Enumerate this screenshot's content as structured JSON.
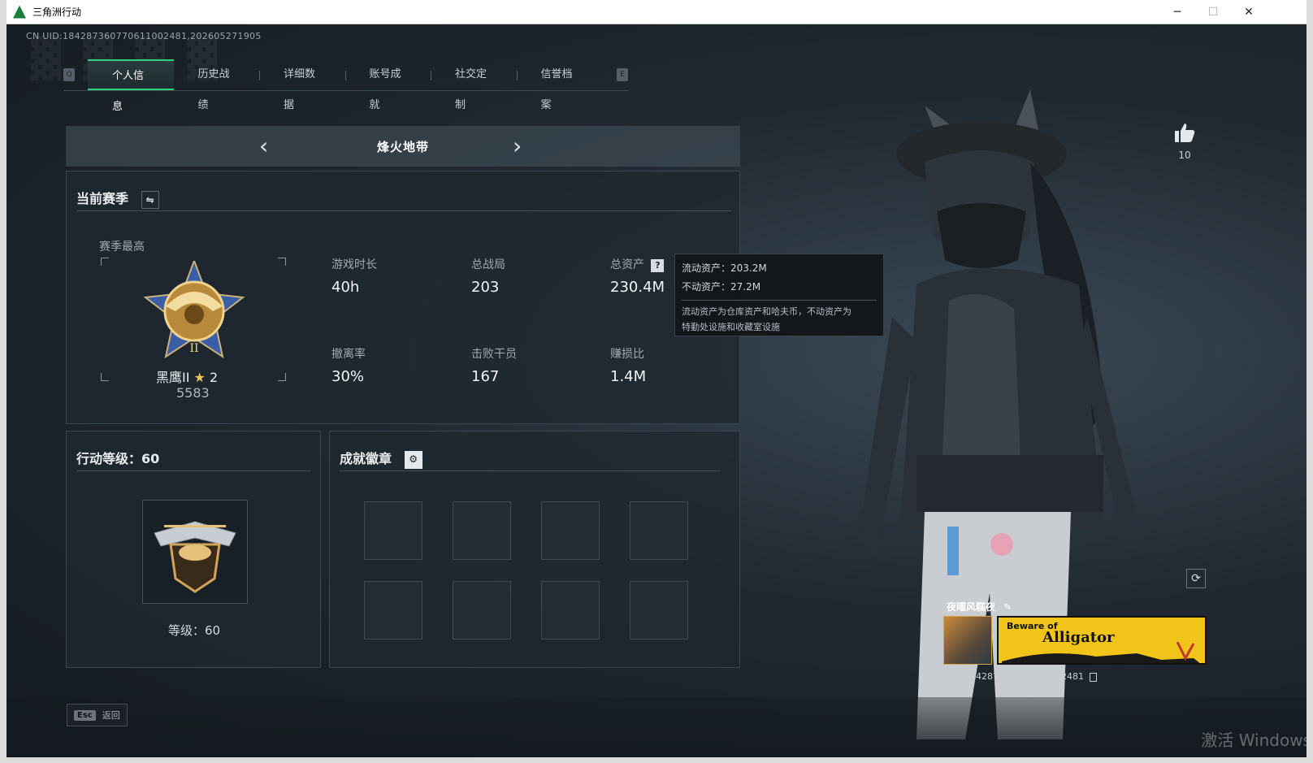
{
  "window": {
    "title": "三角洲行动",
    "controls": {
      "minimize": "─",
      "maximize": "☐",
      "close": "✕"
    }
  },
  "uid_line": "CN UID:1842873607706110024​81,2026052719​05",
  "tabs": {
    "left_key": "Q",
    "right_key": "E",
    "items": [
      "个人信息",
      "历史战绩",
      "详细数据",
      "账号成就",
      "社交定制",
      "信誉档案"
    ],
    "active_index": 0
  },
  "map_selector": {
    "name": "烽火地带",
    "prev": "‹",
    "next": "›"
  },
  "season": {
    "title": "当前赛季",
    "switch_icon": "⇋",
    "best_label": "赛季最高",
    "rank_name": "黑鹰II",
    "rank_stars": "2",
    "rank_points": "5583",
    "stats": [
      {
        "label": "游戏时长",
        "value": "40h"
      },
      {
        "label": "总战局",
        "value": "203"
      },
      {
        "label": "总资产",
        "value": "230.4M",
        "help": "?"
      },
      {
        "label": "撤离率",
        "value": "30%"
      },
      {
        "label": "击败干员",
        "value": "167"
      },
      {
        "label": "赚损比",
        "value": "1.4M"
      }
    ]
  },
  "tooltip": {
    "liquid": "流动资产：203.2M",
    "fixed": "不动资产：27.2M",
    "note_line1": "流动资产为仓库资产和哈夫币，不动资产为",
    "note_line2": "特勤处设施和收藏室设施"
  },
  "action_level": {
    "title": "行动等级：60",
    "level_text": "等级：60"
  },
  "badges": {
    "title": "成就徽章",
    "gear_icon": "⚙",
    "slots": 8
  },
  "profile": {
    "likes": "10",
    "nickname": "夜曜风糕夜",
    "edit_icon": "✎",
    "banner_small": "Beware of",
    "banner_big": "Alligator",
    "id_line": "编号18428736077061100248​1",
    "refresh_icon": "⟳"
  },
  "footer": {
    "esc_key": "Esc",
    "back_label": "返回"
  },
  "watermark": "激活 Windows",
  "colors": {
    "accent": "#2fd07a",
    "panel": "#1f2830",
    "banner": "#f0c419"
  }
}
